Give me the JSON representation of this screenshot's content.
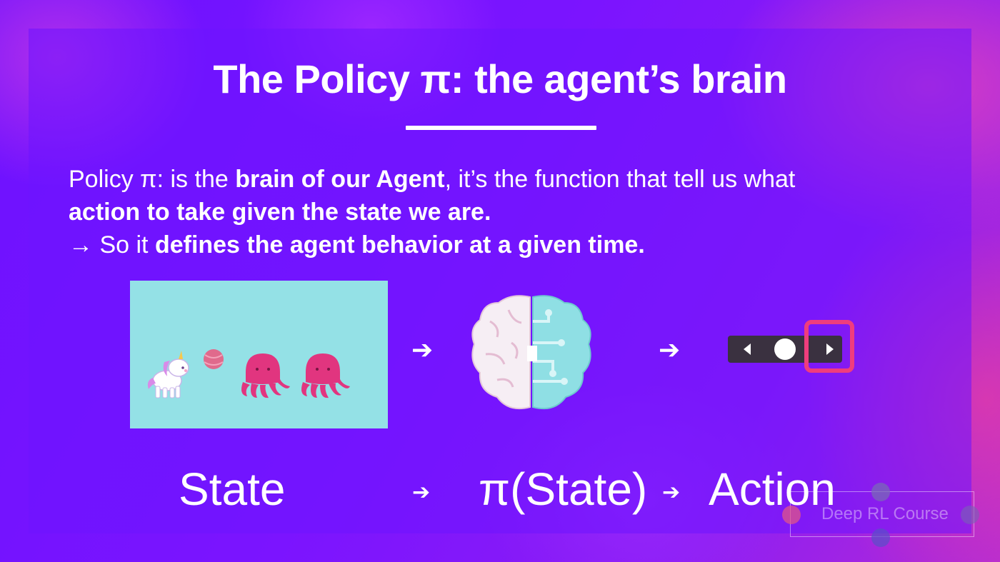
{
  "slide": {
    "title": "The Policy π: the agent’s brain",
    "paragraph": {
      "line1_a": "Policy π: is the ",
      "line1_b": "brain of our Agent",
      "line1_c": ", it’s the function that tell us what",
      "line2": "action to take given the state we are.",
      "line3_a": "→ So it ",
      "line3_b": "defines the agent behavior at a given time."
    },
    "flow_arrow": "➔",
    "bottom": {
      "state": "State",
      "arrow": "➔",
      "policy": "π(State)",
      "arrow2": "➔",
      "action": "Action"
    },
    "watermark": "Deep RL Course"
  },
  "icons": {
    "state_scene": "unicorn-ball-octopus-icon",
    "brain": "brain-circuit-icon",
    "action": "left-right-action-selector-icon"
  },
  "colors": {
    "background": "#6a12ff",
    "accent_pink": "#ef3d7d",
    "scene_bg": "#94e1e6"
  }
}
